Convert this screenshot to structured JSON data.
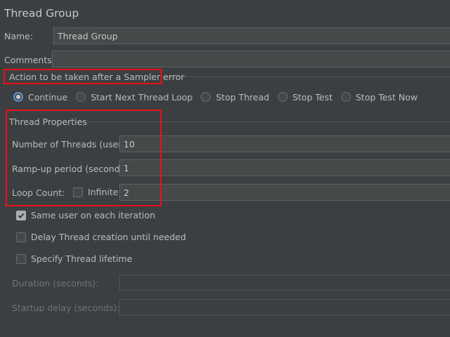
{
  "header": {
    "title": "Thread Group"
  },
  "name": {
    "label": "Name:",
    "value": "Thread Group"
  },
  "comments": {
    "label": "Comments:",
    "value": ""
  },
  "sampler_error": {
    "legend": "Action to be taken after a Sampler error",
    "options": [
      {
        "label": "Continue",
        "selected": true
      },
      {
        "label": "Start Next Thread Loop",
        "selected": false
      },
      {
        "label": "Stop Thread",
        "selected": false
      },
      {
        "label": "Stop Test",
        "selected": false
      },
      {
        "label": "Stop Test Now",
        "selected": false
      }
    ]
  },
  "thread_props": {
    "legend": "Thread Properties",
    "threads_label": "Number of Threads (users):",
    "threads_value": "10",
    "rampup_label": "Ramp-up period (seconds):",
    "rampup_value": "1",
    "loop_label": "Loop Count:",
    "infinite_label": "Infinite",
    "infinite_checked": false,
    "loop_value": "2"
  },
  "options": {
    "same_user_label": "Same user on each iteration",
    "same_user_checked": true,
    "delay_label": "Delay Thread creation until needed",
    "delay_checked": false,
    "lifetime_label": "Specify Thread lifetime",
    "lifetime_checked": false
  },
  "lifetime": {
    "duration_label": "Duration (seconds):",
    "duration_value": "",
    "startup_label": "Startup delay (seconds):",
    "startup_value": ""
  },
  "colors": {
    "background": "#3c3f41",
    "field": "#45494a",
    "highlight": "#e8101a",
    "radio_accent": "#5d8fc7"
  }
}
